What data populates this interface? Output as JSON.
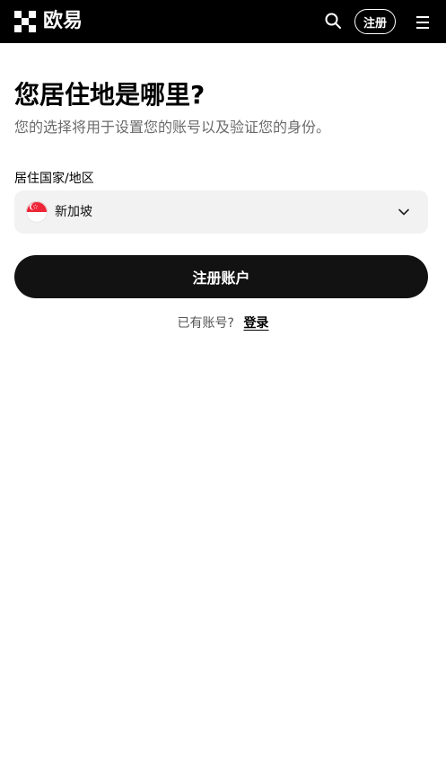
{
  "header": {
    "brand_name": "欧易",
    "register_label": "注册",
    "icons": [
      "okx-logo",
      "search-icon",
      "menu-icon"
    ]
  },
  "main": {
    "title": "您居住地是哪里?",
    "subtitle": "您的选择将用于设置您的账号以及验证您的身份。",
    "country_field": {
      "label": "居住国家/地区",
      "value": "新加坡",
      "flag_icon": "singapore-flag-icon"
    },
    "submit_label": "注册账户",
    "login_prompt": "已有账号?",
    "login_link": "登录"
  },
  "colors": {
    "header_bg": "#000000",
    "button_bg": "#121212",
    "field_bg": "#f2f2f2",
    "subtitle": "#6b6b6b",
    "flag_red": "#ee2536"
  }
}
